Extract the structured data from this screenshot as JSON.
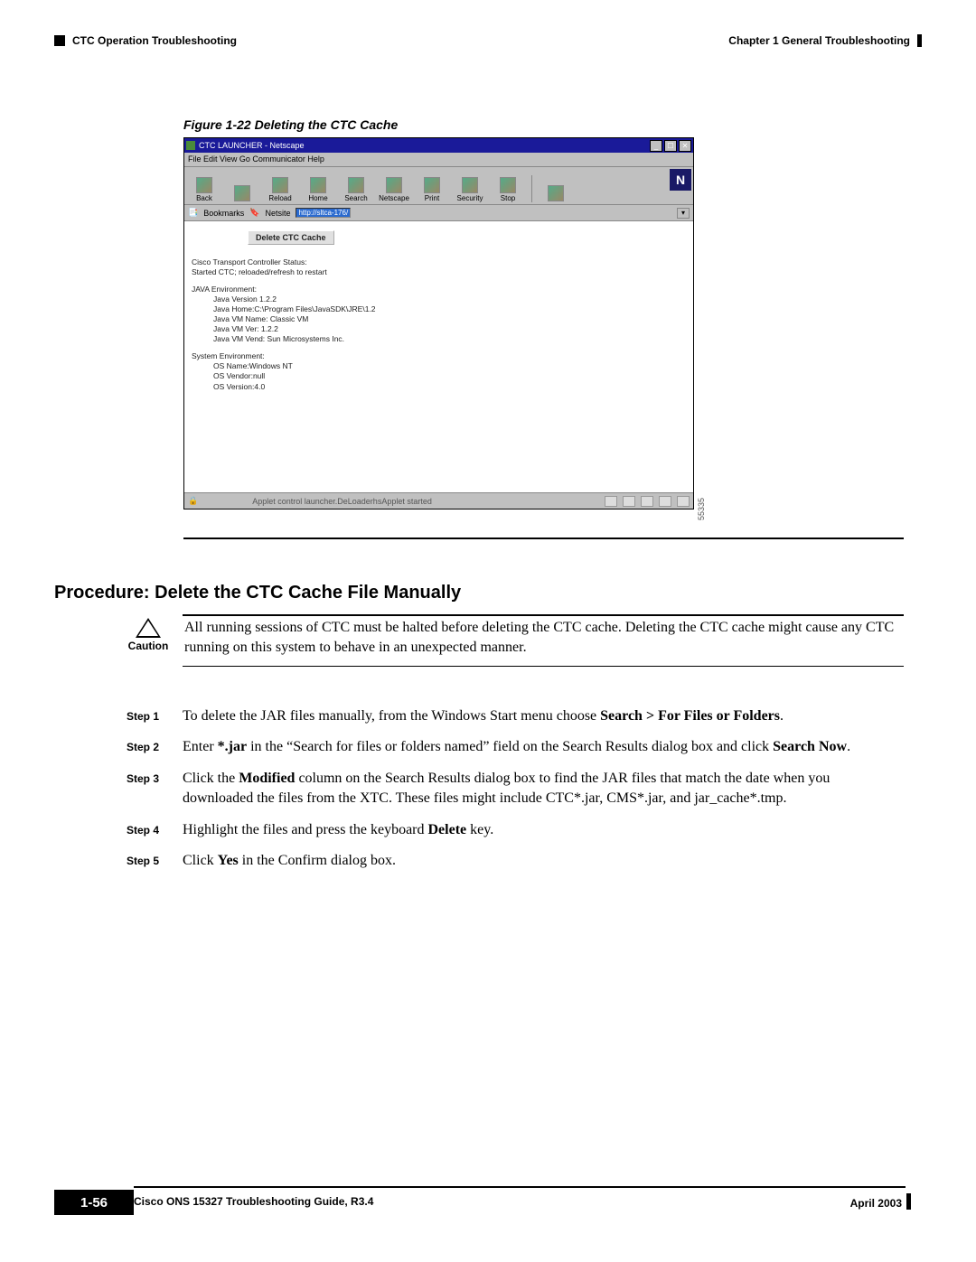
{
  "header": {
    "chapter": "Chapter 1    General Troubleshooting",
    "section": "CTC Operation Troubleshooting"
  },
  "figure": {
    "caption": "Figure 1-22   Deleting the CTC Cache"
  },
  "browser": {
    "title": "CTC LAUNCHER - Netscape",
    "menu": "File  Edit  View  Go  Communicator  Help",
    "toolbar": [
      "Back",
      "",
      "Reload",
      "Home",
      "Search",
      "Netscape",
      "Print",
      "Security",
      "Stop",
      ""
    ],
    "bookmarks_label": "Bookmarks",
    "netsite_label": "Netsite",
    "netsite_value": "http://sltca-176/",
    "button_label": "Delete CTC Cache",
    "status_heading": "Cisco Transport Controller Status:",
    "status_line": "Started CTC; reloaded/refresh to restart",
    "java_heading": "JAVA Environment:",
    "java_lines": [
      "Java Version 1.2.2",
      "Java Home:C:\\Program Files\\JavaSDK\\JRE\\1.2",
      "Java VM Name: Classic VM",
      "Java VM Ver: 1.2.2",
      "Java VM Vend: Sun Microsystems Inc."
    ],
    "sys_heading": "System Environment:",
    "sys_lines": [
      "OS Name:Windows NT",
      "OS Vendor:null",
      "OS Version:4.0"
    ],
    "status_left": "🔒",
    "status_mid": "Applet control launcher.DeLoaderhsApplet started",
    "side_label": "55335"
  },
  "procedure": {
    "heading": "Procedure: Delete the CTC Cache File Manually"
  },
  "caution": {
    "label": "Caution",
    "text": "All running sessions of CTC must be halted before deleting the CTC cache. Deleting the CTC cache might cause any CTC running on this system to behave in an unexpected manner."
  },
  "steps": [
    {
      "label": "Step 1",
      "parts": [
        {
          "t": "To delete the JAR files manually, from the Windows Start menu choose "
        },
        {
          "t": "Search > For Files or Folders",
          "b": true
        },
        {
          "t": "."
        }
      ]
    },
    {
      "label": "Step 2",
      "parts": [
        {
          "t": "Enter "
        },
        {
          "t": "*.jar",
          "b": true
        },
        {
          "t": " in the “Search for files or folders named” field on the Search Results dialog box and click "
        },
        {
          "t": "Search Now",
          "b": true
        },
        {
          "t": "."
        }
      ]
    },
    {
      "label": "Step 3",
      "parts": [
        {
          "t": "Click the "
        },
        {
          "t": "Modified",
          "b": true
        },
        {
          "t": " column on the Search Results dialog box to find the JAR files that match the date when you downloaded the files from the XTC. These files might include CTC*.jar, CMS*.jar, and jar_cache*.tmp."
        }
      ]
    },
    {
      "label": "Step 4",
      "parts": [
        {
          "t": "Highlight the files and press the keyboard "
        },
        {
          "t": "Delete",
          "b": true
        },
        {
          "t": " key."
        }
      ]
    },
    {
      "label": "Step 5",
      "parts": [
        {
          "t": "Click "
        },
        {
          "t": "Yes",
          "b": true
        },
        {
          "t": " in the Confirm dialog box."
        }
      ]
    }
  ],
  "footer": {
    "title": "Cisco ONS 15327 Troubleshooting Guide, R3.4",
    "page": "1-56",
    "date": "April 2003"
  }
}
